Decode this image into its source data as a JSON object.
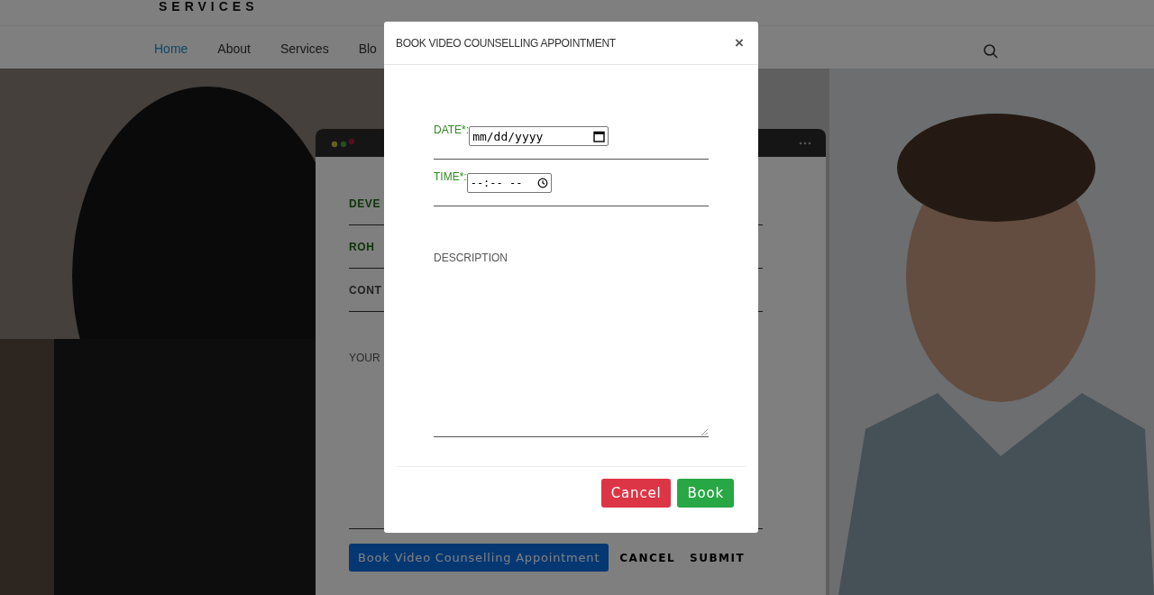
{
  "logo": "SERVICES",
  "nav": {
    "items": [
      {
        "label": "Home",
        "selected": true
      },
      {
        "label": "About",
        "selected": false
      },
      {
        "label": "Services",
        "selected": false
      },
      {
        "label": "Blo",
        "selected": false
      }
    ]
  },
  "card": {
    "fields": [
      {
        "label": "DEVE",
        "kind": "green"
      },
      {
        "label": "ROH",
        "kind": "green"
      },
      {
        "label": "CONT",
        "kind": "grey"
      }
    ],
    "message_label": "YOUR",
    "buttons": [
      {
        "label": "Book Video Counselling Appointment",
        "kind": "primary"
      },
      {
        "label": "CANCEL",
        "kind": "text"
      },
      {
        "label": "SUBMIT",
        "kind": "text"
      }
    ]
  },
  "modal": {
    "title": "BOOK VIDEO COUNSELLING APPOINTMENT",
    "close": "×",
    "date": {
      "label": "DATE*:",
      "placeholder": "mm/dd/yyyy"
    },
    "time": {
      "label": "TIME*:",
      "placeholder": "--:-- --"
    },
    "description": {
      "label": "DESCRIPTION"
    },
    "buttons": [
      {
        "label": "Cancel",
        "kind": "danger"
      },
      {
        "label": "Book",
        "kind": "success"
      }
    ]
  }
}
